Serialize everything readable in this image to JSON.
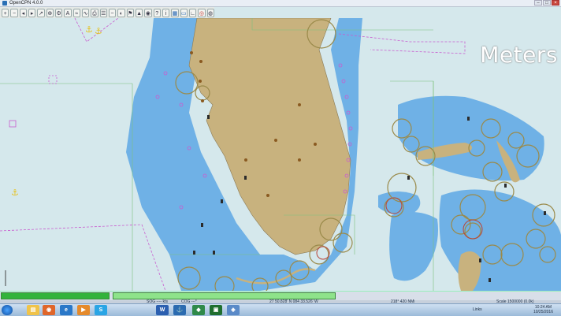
{
  "window": {
    "title": "OpenCPN 4.0.0"
  },
  "toolbar": {
    "buttons": [
      {
        "name": "zoom-in",
        "glyph": "+"
      },
      {
        "name": "zoom-out",
        "glyph": "−"
      },
      {
        "name": "scale-in",
        "glyph": "◂"
      },
      {
        "name": "scale-out",
        "glyph": "▸"
      },
      {
        "name": "route",
        "glyph": "↗"
      },
      {
        "name": "auto-follow",
        "glyph": "⊕"
      },
      {
        "name": "settings",
        "glyph": "⚙"
      },
      {
        "name": "text",
        "glyph": "A"
      },
      {
        "name": "current",
        "glyph": "≈"
      },
      {
        "name": "tide",
        "glyph": "∿"
      },
      {
        "name": "print",
        "glyph": "⎙"
      },
      {
        "name": "route-manager",
        "glyph": "☰"
      },
      {
        "name": "track",
        "glyph": "~"
      },
      {
        "name": "color-scheme",
        "glyph": "◐"
      },
      {
        "name": "mob",
        "glyph": "⚑"
      },
      {
        "name": "ais",
        "glyph": "▲"
      },
      {
        "name": "gps",
        "glyph": "◉"
      },
      {
        "name": "help",
        "glyph": "?"
      },
      {
        "name": "info",
        "glyph": "i"
      },
      {
        "name": "grid",
        "glyph": "▦"
      },
      {
        "name": "dashboard",
        "glyph": "▭"
      },
      {
        "name": "ruler",
        "glyph": "∟"
      },
      {
        "name": "globe",
        "glyph": "◎"
      },
      {
        "name": "lifebuoy",
        "glyph": "◍"
      }
    ]
  },
  "chart": {
    "units_watermark": "Meters"
  },
  "status": {
    "sog": "SOG ---- kts",
    "cog": "COG ---°",
    "cursor_position": "27 50.828' N 084 33.526' W",
    "bearing_distance": "218° 420 NMi",
    "scale": "Scale 1500000 (0.0k)"
  },
  "progress": {
    "left_fraction": 1.0,
    "main_fraction": 1.0
  },
  "taskbar": {
    "apps": [
      "windows-explorer",
      "firefox",
      "internet-explorer",
      "media-player",
      "skype",
      "word",
      "opencpn",
      "app-7",
      "app-8",
      "app-9"
    ],
    "tray_label": "Links",
    "time": "10:24 AM",
    "date": "10/25/2016"
  },
  "colors": {
    "land": "#c8b27e",
    "shallow": "#6fb1e6",
    "deep": "#d5e8ec",
    "magenta": "#c95ccf",
    "ring": "#9a8a4a"
  }
}
